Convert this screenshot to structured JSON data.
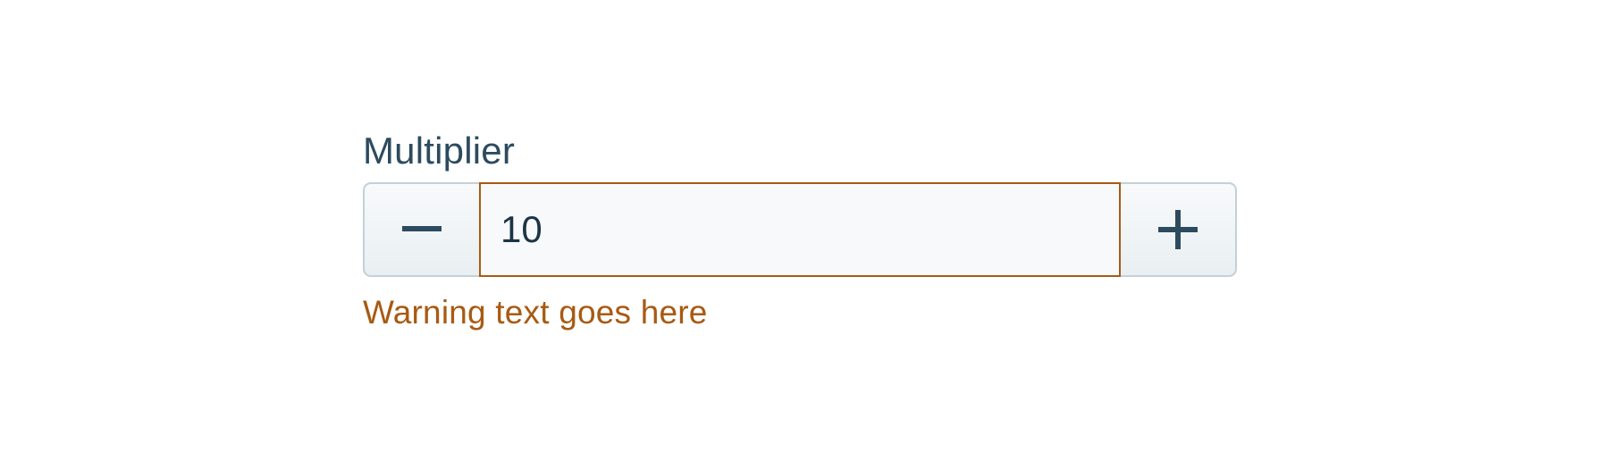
{
  "field": {
    "label": "Multiplier",
    "value": "10",
    "warning": "Warning text goes here"
  },
  "controls": {
    "decrement_icon": "minus-icon",
    "increment_icon": "plus-icon"
  },
  "colors": {
    "label": "#2d4b5f",
    "warning": "#a85a12",
    "input_border": "#aa5a12",
    "icon": "#2d4b5f",
    "stepper_border": "#c4d0d7"
  }
}
